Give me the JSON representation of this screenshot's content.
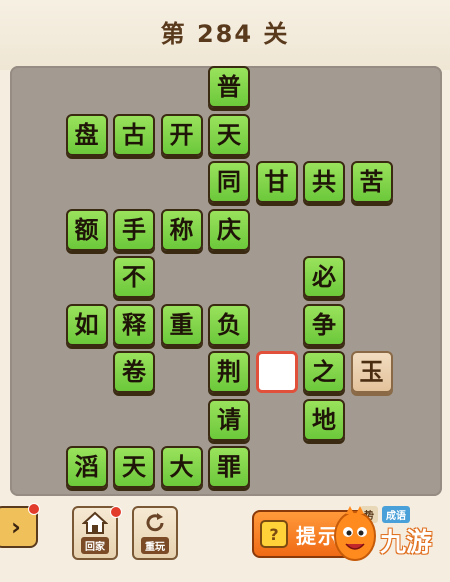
{
  "header": {
    "level_title": "第 284 关"
  },
  "board": {
    "tiles": [
      {
        "id": "t-pu",
        "char": "普",
        "row": 0,
        "col": 4
      },
      {
        "id": "t-pan",
        "char": "盘",
        "row": 1,
        "col": 1
      },
      {
        "id": "t-gu",
        "char": "古",
        "row": 1,
        "col": 2
      },
      {
        "id": "t-kai",
        "char": "开",
        "row": 1,
        "col": 3
      },
      {
        "id": "t-tian1",
        "char": "天",
        "row": 1,
        "col": 4
      },
      {
        "id": "t-tong",
        "char": "同",
        "row": 2,
        "col": 4
      },
      {
        "id": "t-gan",
        "char": "甘",
        "row": 2,
        "col": 5
      },
      {
        "id": "t-gong",
        "char": "共",
        "row": 2,
        "col": 6
      },
      {
        "id": "t-ku",
        "char": "苦",
        "row": 2,
        "col": 7
      },
      {
        "id": "t-e",
        "char": "额",
        "row": 3,
        "col": 1
      },
      {
        "id": "t-shou",
        "char": "手",
        "row": 3,
        "col": 2
      },
      {
        "id": "t-cheng",
        "char": "称",
        "row": 3,
        "col": 3
      },
      {
        "id": "t-qing",
        "char": "庆",
        "row": 3,
        "col": 4
      },
      {
        "id": "t-bu",
        "char": "不",
        "row": 4,
        "col": 2
      },
      {
        "id": "t-bi",
        "char": "必",
        "row": 4,
        "col": 6
      },
      {
        "id": "t-ru",
        "char": "如",
        "row": 5,
        "col": 1
      },
      {
        "id": "t-shi",
        "char": "释",
        "row": 5,
        "col": 2
      },
      {
        "id": "t-zhong",
        "char": "重",
        "row": 5,
        "col": 3
      },
      {
        "id": "t-fu",
        "char": "负",
        "row": 5,
        "col": 4
      },
      {
        "id": "t-zheng",
        "char": "争",
        "row": 5,
        "col": 6
      },
      {
        "id": "t-juan",
        "char": "卷",
        "row": 6,
        "col": 2
      },
      {
        "id": "t-jing",
        "char": "荆",
        "row": 6,
        "col": 4
      },
      {
        "id": "t-zhi",
        "char": "之",
        "row": 6,
        "col": 6
      },
      {
        "id": "t-qing2",
        "char": "请",
        "row": 7,
        "col": 4
      },
      {
        "id": "t-di",
        "char": "地",
        "row": 7,
        "col": 6
      },
      {
        "id": "t-tao",
        "char": "滔",
        "row": 8,
        "col": 1
      },
      {
        "id": "t-tian2",
        "char": "天",
        "row": 8,
        "col": 2
      },
      {
        "id": "t-da",
        "char": "大",
        "row": 8,
        "col": 3
      },
      {
        "id": "t-zui",
        "char": "罪",
        "row": 8,
        "col": 4
      }
    ],
    "blank": {
      "row": 6,
      "col": 5
    },
    "options": [
      {
        "id": "opt-yu",
        "char": "玉",
        "row": 6,
        "col": 7
      }
    ]
  },
  "toolbar": {
    "next_label": "›",
    "home_label": "回家",
    "replay_label": "重玩",
    "hint_label": "提示",
    "hint_icon": "?",
    "tag_1": "势",
    "tag_2": "成语",
    "brand": "九游"
  },
  "colors": {
    "tile_green": "#7ed24a",
    "blank_border": "#e0503a",
    "option_tile": "#ebcfa9",
    "board": "#a39a91",
    "hint_orange": "#f58020"
  }
}
